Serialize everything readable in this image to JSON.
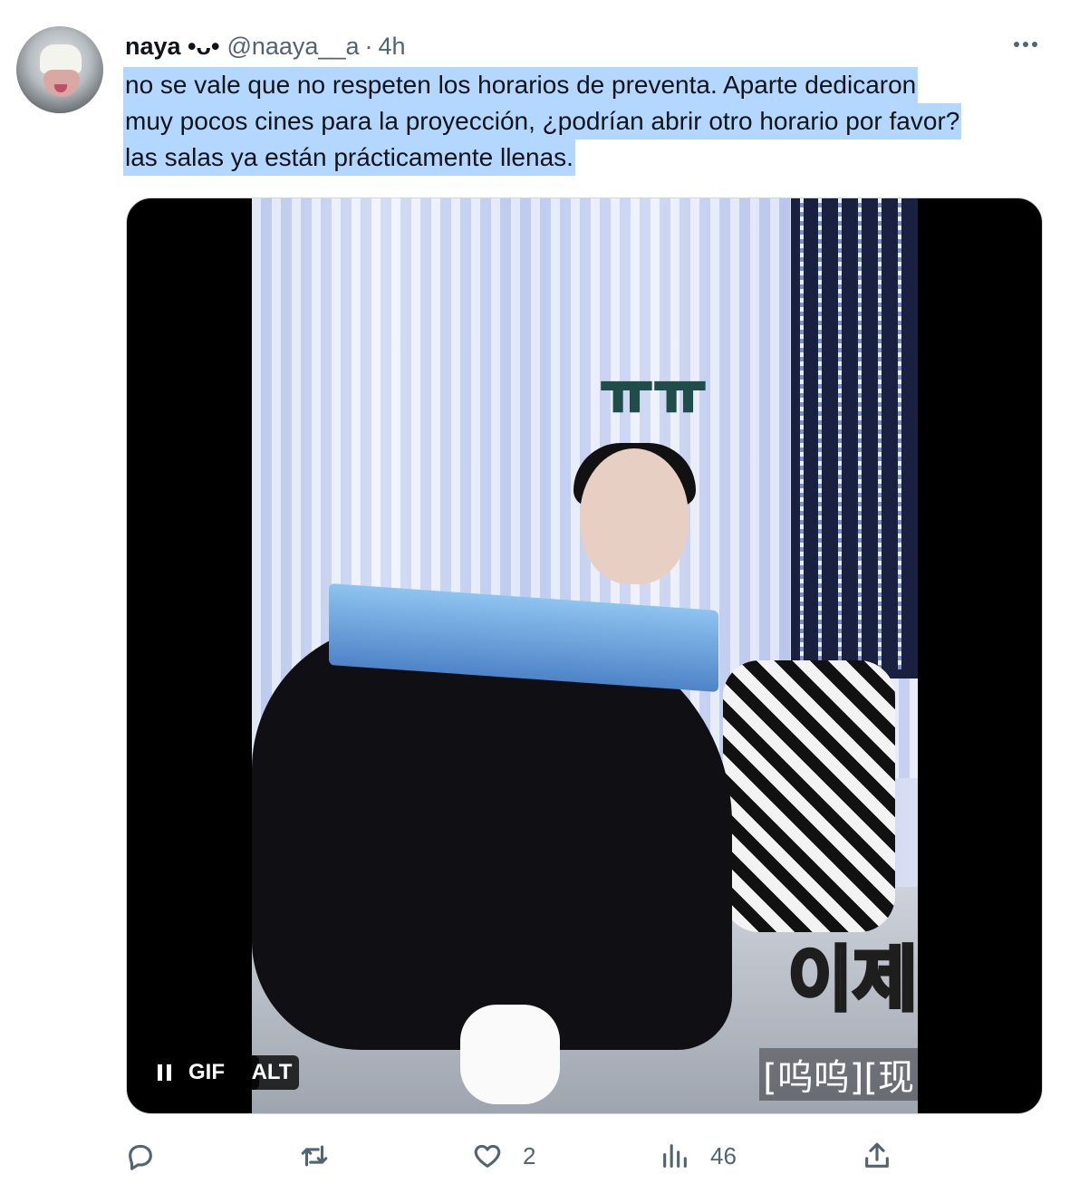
{
  "author": {
    "name": "naya •ᴗ•",
    "handle": "@naaya__a",
    "separator": "·",
    "time": "4h",
    "avatar_icon": "avatar-photo"
  },
  "tweet": {
    "lines": [
      "no se vale que no respeten los horarios de preventa. Aparte dedicaron",
      "muy pocos cines para la proyección, ¿podrían abrir otro horario por favor?",
      "las salas ya están prácticamente llenas."
    ],
    "highlight_color": "#b4d7ff"
  },
  "media": {
    "overlay_text_top": "ㅠㅠ",
    "overlay_text_bottom": "이제",
    "subtitle": "[呜呜][现",
    "gif_label": "GIF",
    "alt_label": "ALT",
    "pause_icon": "pause-icon"
  },
  "actions": {
    "reply": {
      "icon": "reply-icon",
      "count": ""
    },
    "retweet": {
      "icon": "retweet-icon",
      "count": ""
    },
    "like": {
      "icon": "heart-icon",
      "count": "2"
    },
    "views": {
      "icon": "views-icon",
      "count": "46"
    },
    "share": {
      "icon": "share-icon"
    }
  },
  "colors": {
    "text": "#0f1419",
    "secondary": "#536471",
    "media_border": "#cfd9de"
  }
}
